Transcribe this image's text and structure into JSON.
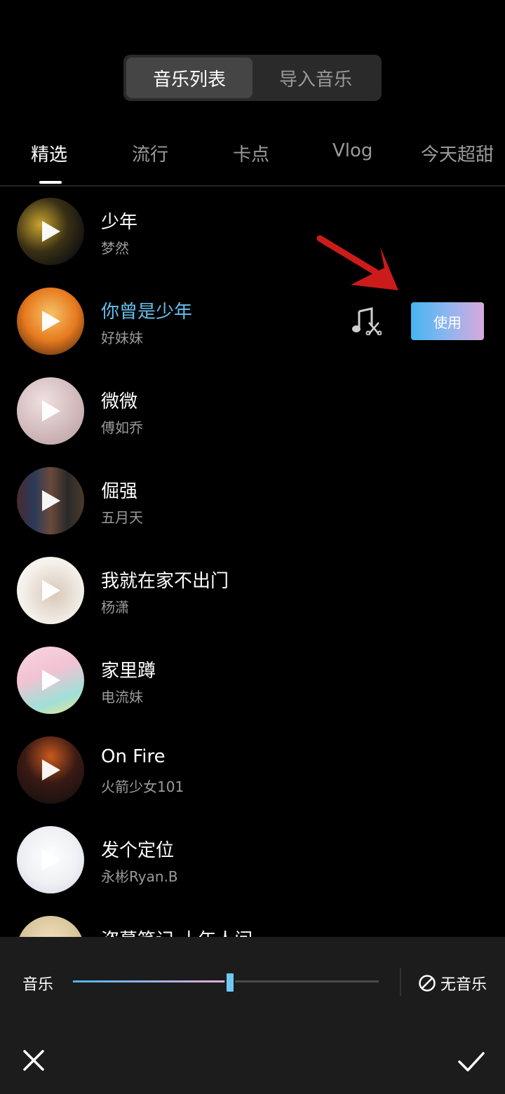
{
  "header": {
    "tabs": [
      {
        "label": "音乐列表",
        "active": true
      },
      {
        "label": "导入音乐",
        "active": false
      }
    ]
  },
  "categories": [
    {
      "label": "精选",
      "active": true
    },
    {
      "label": "流行",
      "active": false
    },
    {
      "label": "卡点",
      "active": false
    },
    {
      "label": "Vlog",
      "active": false
    },
    {
      "label": "今天超甜",
      "active": false
    }
  ],
  "songs": [
    {
      "title": "少年",
      "artist": "梦然",
      "cover_colors": [
        "#2a2410",
        "#7a6a3a"
      ]
    },
    {
      "title": "你曾是少年",
      "artist": "好妹妹",
      "selected": true,
      "cover_colors": [
        "#e77a1e",
        "#f3b25a"
      ]
    },
    {
      "title": "微微",
      "artist": "傅如乔",
      "cover_colors": [
        "#cfb7b9",
        "#e9dadb"
      ]
    },
    {
      "title": "倔强",
      "artist": "五月天",
      "cover_colors": [
        "#3a2a34",
        "#8a6a5a"
      ]
    },
    {
      "title": "我就在家不出门",
      "artist": "杨潇",
      "cover_colors": [
        "#f4f0ea",
        "#d8c8b8"
      ]
    },
    {
      "title": "家里蹲",
      "artist": "电流妹",
      "cover_colors": [
        "#f2c2d2",
        "#9fe0d8"
      ]
    },
    {
      "title": "On Fire",
      "artist": "火箭少女101",
      "cover_colors": [
        "#2a1616",
        "#6a4a3a"
      ]
    },
    {
      "title": "发个定位",
      "artist": "永彬Ryan.B",
      "cover_colors": [
        "#f2f2f2",
        "#cfd6e2"
      ]
    },
    {
      "title": "盗墓笔记·十年人间",
      "artist": "",
      "cover_colors": [
        "#d8c59a",
        "#a88a56"
      ]
    }
  ],
  "selected_actions": {
    "use_label": "使用",
    "cut_icon": "music-cut-icon"
  },
  "bottom": {
    "music_label": "音乐",
    "volume": 0.51,
    "no_music_label": "无音乐",
    "close_icon": "close-icon",
    "confirm_icon": "check-icon"
  },
  "colors": {
    "accent": "#63c2ee",
    "annotation_arrow": "#cc1b1b"
  }
}
